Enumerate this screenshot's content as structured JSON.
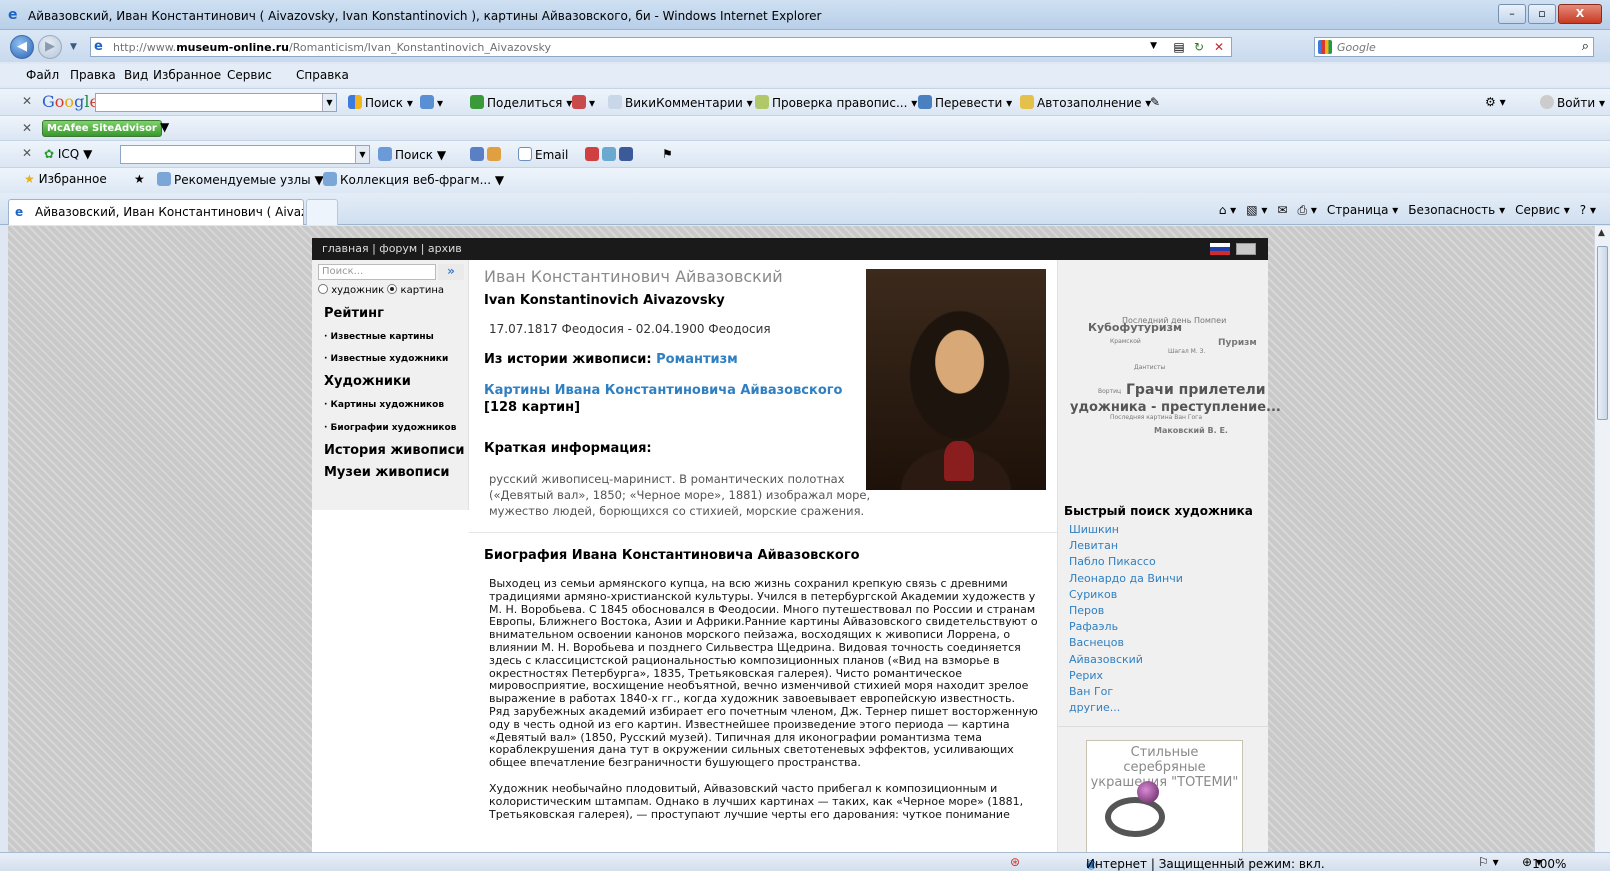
{
  "window": {
    "title": "Айвазовский, Иван Константинович ( Aivazovsky, Ivan Konstantinovich ), картины Айвазовского, би - Windows Internet Explorer",
    "buttons": {
      "minimize": "–",
      "maximize": "▫",
      "close": "X"
    }
  },
  "address_bar": {
    "url_prefix": "http://www.",
    "url_domain": "museum-online.ru",
    "url_path": "/Romanticism/Ivan_Konstantinovich_Aivazovsky",
    "search_placeholder": "Google"
  },
  "menu": [
    "Файл",
    "Правка",
    "Вид",
    "Избранное",
    "Сервис",
    "Справка"
  ],
  "google_toolbar": {
    "search_label": "Поиск",
    "share_label": "Поделиться",
    "wiki_label": "ВикиКомментарии",
    "spell_label": "Проверка правопис...",
    "translate_label": "Перевести",
    "autofill_label": "Автозаполнение",
    "login_label": "Войти"
  },
  "mcafee_toolbar": {
    "label": "McAfee SiteAdvisor"
  },
  "icq_toolbar": {
    "label": "ICQ",
    "search_label": "Поиск",
    "email_label": "Email"
  },
  "favorites": {
    "label": "Избранное",
    "items": [
      "Рекомендуемые узлы",
      "Коллекция веб-фрагм..."
    ]
  },
  "tab": {
    "label": "Айвазовский, Иван Константинович ( Aivazovs..."
  },
  "command_bar": [
    "Страница ▾",
    "Безопасность ▾",
    "Сервис ▾"
  ],
  "site": {
    "top_nav": "главная | форум | архив",
    "left": {
      "search_placeholder": "Поиск...",
      "go": "»",
      "radio_artist": "художник",
      "radio_painting": "картина",
      "rating": "Рейтинг",
      "famous_paintings": "· Известные картины",
      "famous_artists": "· Известные художники",
      "artists": "Художники",
      "artists_paintings": "· Картины художников",
      "artists_bios": "· Биографии художников",
      "history": "История живописи",
      "museums": "Музеи живописи"
    },
    "main": {
      "name_ru": "Иван Константинович Айвазовский",
      "name_en": "Ivan Konstantinovich Aivazovsky",
      "dates": "17.07.1817 Феодосия - 02.04.1900 Феодосия",
      "history_label": "Из истории живописи:",
      "history_link": "Романтизм",
      "paintings_link": "Картины Ивана Константиновича Айвазовского",
      "paintings_count": "[128 картин]",
      "brief_heading": "Краткая информация:",
      "brief_text": "русский живописец-маринист. В романтических полотнах («Девятый вал», 1850; «Черное море», 1881) изображал море, мужество людей, борющихся со стихией, морские сражения.",
      "bio_heading": "Биография Ивана Константиновича Айвазовского",
      "bio_p1": "Выходец из семьи армянского купца, на всю жизнь сохранил крепкую связь с древними традициями армяно-христианской культуры. Учился в петербургской Академии художеств у М. Н. Воробьева. С 1845 обосновался в Феодосии. Много путешествовал по России и странам Европы, Ближнего Востока, Азии и Африки.Ранние картины Айвазовского свидетельствуют о внимательном освоении канонов морского пейзажа, восходящих к живописи Лоррена, о влиянии М. Н. Воробьева и позднего Сильвестра Щедрина. Видовая точность соединяется здесь с классицистской рациональностью композиционных планов («Вид на взморье в окрестностях Петербурга», 1835, Третьяковская галерея). Чисто романтическое мировосприятие, восхищение необъятной, вечно изменчивой стихией моря находит зрелое выражение в работах 1840-х гг., когда художник завоевывает европейскую известность. Ряд зарубежных академий избирает его почетным членом, Дж. Тернер пишет восторженную оду в честь одной из его картин. Известнейшее произведение этого периода — картина «Девятый вал» (1850, Русский музей). Типичная для иконографии романтизма тема кораблекрушения дана тут в окружении сильных светотеневых эффектов, усиливающих общее впечатление безграничности бушующего пространства.",
      "bio_p2": "Художник необычайно плодовитый, Айвазовский часто прибегал к композиционным и колористическим штампам. Однако в лучших картинах — таких, как «Черное море» (1881, Третьяковская галерея), — проступают лучшие черты его дарования: чуткое понимание"
    },
    "right": {
      "cloud": {
        "w1": "Последний день Помпеи",
        "w2": "Кубофутуризм",
        "w3": "Пуризм",
        "w4": "Крамской",
        "w5": "Шагал М. З.",
        "w6": "Дантисты",
        "w7": "Вортиц",
        "w8": "Грачи прилетели",
        "w9": "удожника - преступление...",
        "w10": "Последняя картина Ван Гога",
        "w11": "Маковский В. Е."
      },
      "quick_heading": "Быстрый поиск художника",
      "quick_links": [
        "Шишкин",
        "Левитан",
        "Пабло Пикассо",
        "Леонардо да Винчи",
        "Суриков",
        "Перов",
        "Рафаэль",
        "Васнецов",
        "Айвазовский",
        "Рерих",
        "Ван Гог",
        "другие..."
      ],
      "ad_text": "Стильные серебряные украшения \"ТОТЕМИ\""
    }
  },
  "status": {
    "zone": "Интернет | Защищенный режим: вкл.",
    "zoom": "100%"
  }
}
